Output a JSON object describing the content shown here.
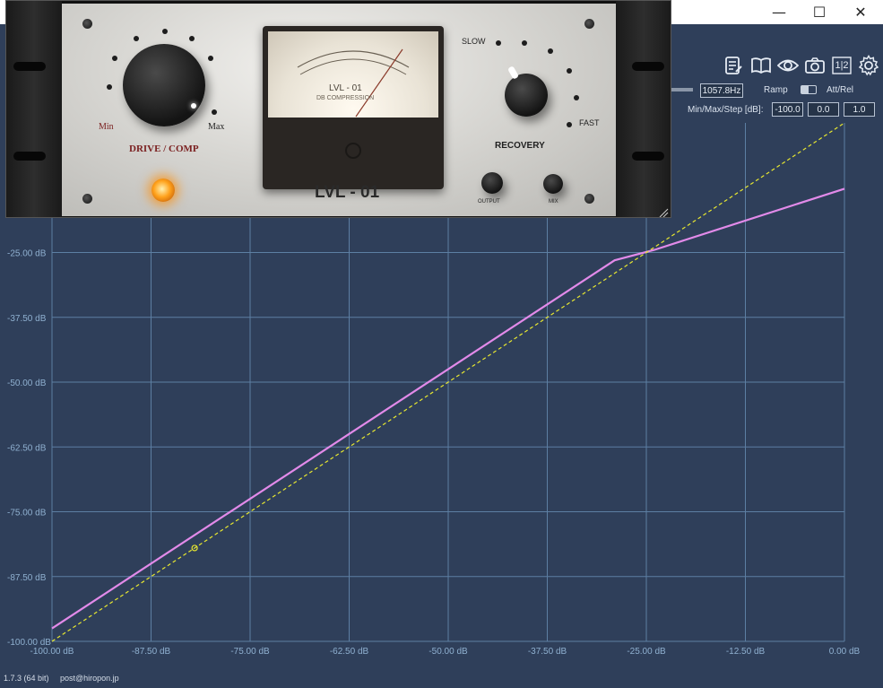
{
  "window": {
    "minimize_glyph": "—",
    "maximize_glyph": "☐",
    "close_glyph": "✕"
  },
  "toolbar": {
    "icons": [
      "notes-icon",
      "book-icon",
      "eye-icon",
      "camera-icon",
      "compare-icon",
      "gear-icon"
    ],
    "compare_label": "1|2"
  },
  "controls": {
    "frequency_value": "1057.8Hz",
    "ramp_label": "Ramp",
    "att_rel_label": "Att/Rel",
    "minmaxstep_label": "Min/Max/Step [dB]:",
    "min_value": "-100.0",
    "max_value": "0.0",
    "step_value": "1.0"
  },
  "plugin": {
    "drive_label": "DRIVE / COMP",
    "min_label": "Min",
    "max_label": "Max",
    "slow_label": "SLOW",
    "fast_label": "FAST",
    "recovery_label": "RECOVERY",
    "output_label": "OUTPUT",
    "mix_label": "MIX",
    "meter_title": "LVL - 01",
    "meter_subtitle": "DB COMPRESSION",
    "brand_name": "LVL - 01"
  },
  "status": {
    "version": "1.7.3 (64 bit)",
    "email": "post@hiropon.jp"
  },
  "colors": {
    "background": "#2f3f5a",
    "grid": "#5d7fa3",
    "curve": "#e28ae9",
    "reference": "#e8e830"
  },
  "chart_data": {
    "type": "line",
    "xlim": [
      -100,
      0
    ],
    "ylim": [
      -100,
      0
    ],
    "x_ticks": [
      "-100.00 dB",
      "-87.50 dB",
      "-75.00 dB",
      "-62.50 dB",
      "-50.00 dB",
      "-37.50 dB",
      "-25.00 dB",
      "-12.50 dB",
      "0.00 dB"
    ],
    "y_ticks": [
      "-25.00 dB",
      "-37.50 dB",
      "-50.00 dB",
      "-62.50 dB",
      "-75.00 dB",
      "-87.50 dB",
      "-100.00 dB"
    ],
    "grid": true,
    "series": [
      {
        "style": "solid",
        "color": "#e28ae9",
        "x": [
          -100,
          -29,
          -24,
          0
        ],
        "y": [
          -97.5,
          -26.5,
          -24.5,
          -12.7
        ]
      },
      {
        "style": "dashed",
        "color": "#e8e830",
        "x": [
          -100,
          0
        ],
        "y": [
          -100,
          0
        ]
      }
    ],
    "marker": {
      "x": -82,
      "y": -82
    }
  }
}
